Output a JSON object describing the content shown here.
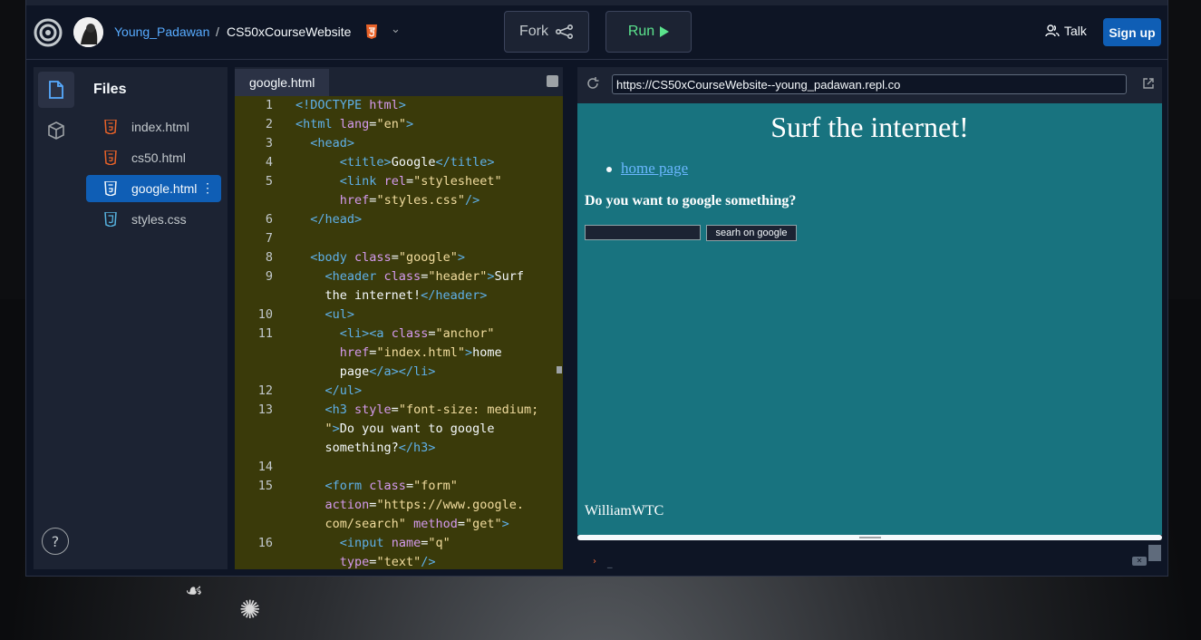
{
  "header": {
    "user": "Young_Padawan",
    "separator": "/",
    "repl_name": "CS50xCourseWebsite",
    "fork_label": "Fork",
    "run_label": "Run",
    "talk_label": "Talk",
    "signup_label": "Sign up"
  },
  "sidebar": {
    "title": "Files",
    "help_label": "?",
    "files": [
      {
        "name": "index.html",
        "type": "html"
      },
      {
        "name": "cs50.html",
        "type": "html"
      },
      {
        "name": "google.html",
        "type": "html",
        "active": true
      },
      {
        "name": "styles.css",
        "type": "css"
      }
    ]
  },
  "editor": {
    "tab_label": "google.html",
    "line_numbers": [
      "1",
      "2",
      "3",
      "4",
      "5",
      "6",
      "7",
      "8",
      "9",
      "10",
      "11",
      "12",
      "13",
      "14",
      "15",
      "16"
    ]
  },
  "webview": {
    "url": "https://CS50xCourseWebsite--young_padawan.repl.co",
    "page": {
      "heading": "Surf the internet!",
      "link": "home page",
      "question": "Do you want to google something?",
      "search_input_value": "",
      "search_button": "searh on google",
      "footer": "WilliamWTC"
    },
    "console_prompt": "›",
    "console_cursor": "_"
  },
  "colors": {
    "accent_blue": "#0f5eb5",
    "run_green": "#5be38d",
    "editor_bg": "#3a3a0a",
    "page_bg": "#18737f"
  }
}
